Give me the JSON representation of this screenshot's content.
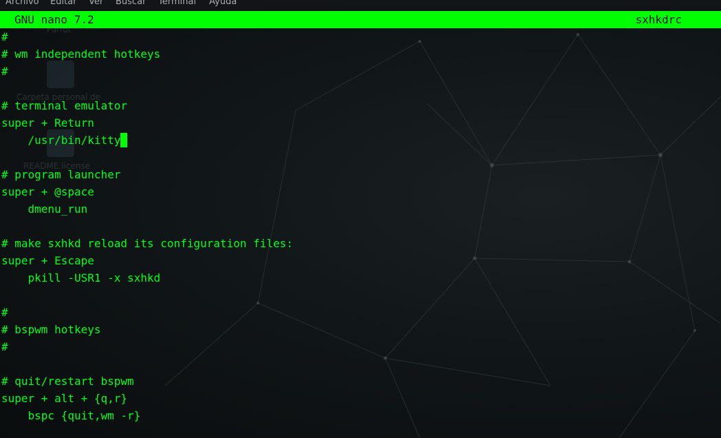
{
  "menubar": {
    "items": [
      "Archivo",
      "Editar",
      "Ver",
      "Buscar",
      "Terminal",
      "Ayuda"
    ]
  },
  "desktop_ghosts": {
    "items": [
      "Parrot",
      "Carpeta personal de",
      "README.license"
    ]
  },
  "titlebar": {
    "app_version": "GNU nano 7.2",
    "filename": "sxhkdrc"
  },
  "colors": {
    "accent_green": "#00ff00",
    "text_green": "#00ff1a"
  },
  "editor": {
    "lines": [
      "#",
      "# wm independent hotkeys",
      "#",
      "",
      "# terminal emulator",
      "super + Return",
      "    /usr/bin/kitty",
      "",
      "# program launcher",
      "super + @space",
      "    dmenu_run",
      "",
      "# make sxhkd reload its configuration files:",
      "super + Escape",
      "    pkill -USR1 -x sxhkd",
      "",
      "#",
      "# bspwm hotkeys",
      "#",
      "",
      "# quit/restart bspwm",
      "super + alt + {q,r}",
      "    bspc {quit,wm -r}"
    ],
    "cursor_line": 6
  }
}
